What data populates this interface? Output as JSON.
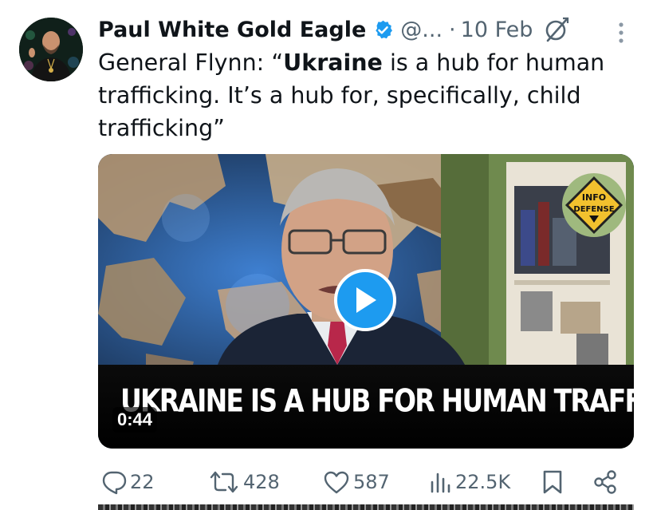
{
  "tweet": {
    "author_name": "Paul White Gold Eagle",
    "handle": "@...",
    "date_separator": "·",
    "date": "10 Feb",
    "text_prefix": "General Flynn: “",
    "text_bold": "Ukraine",
    "text_suffix": " is a hub for human trafficking. It’s a hub for, specifically, child trafficking”"
  },
  "media": {
    "caption": "UKRAINE IS A HUB FOR HUMAN TRAFFICKING",
    "duration": "0:44",
    "logo_line1": "INFO",
    "logo_line2": "DEFENSE"
  },
  "actions": {
    "replies": "22",
    "reposts": "428",
    "likes": "587",
    "views": "22.5K"
  },
  "colors": {
    "accent": "#1d9bf0",
    "secondary_text": "#536471",
    "primary_text": "#0f1419"
  },
  "icons": [
    "verified-badge-icon",
    "grok-icon",
    "more-options-icon",
    "play-icon",
    "reply-icon",
    "repost-icon",
    "like-icon",
    "views-icon",
    "bookmark-icon",
    "share-icon"
  ]
}
